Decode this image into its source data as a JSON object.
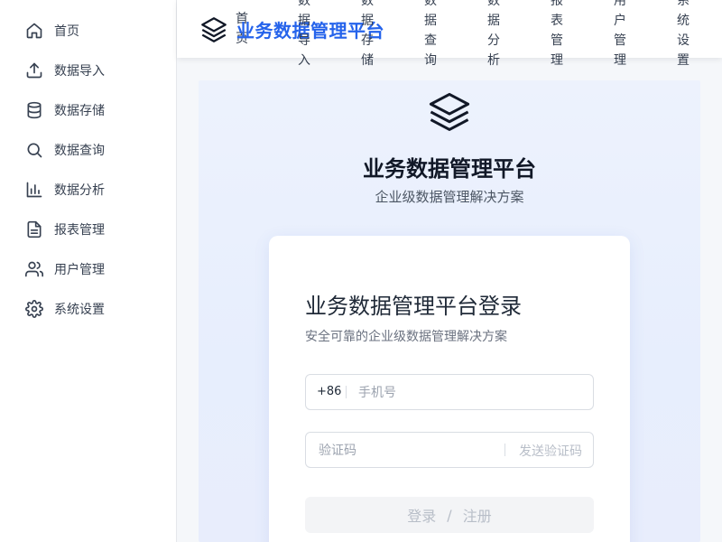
{
  "sidebar": {
    "items": [
      {
        "label": "首页",
        "icon": "home-icon"
      },
      {
        "label": "数据导入",
        "icon": "upload-icon"
      },
      {
        "label": "数据存储",
        "icon": "database-icon"
      },
      {
        "label": "数据查询",
        "icon": "search-icon"
      },
      {
        "label": "数据分析",
        "icon": "bar-chart-icon"
      },
      {
        "label": "报表管理",
        "icon": "file-text-icon"
      },
      {
        "label": "用户管理",
        "icon": "users-icon"
      },
      {
        "label": "系统设置",
        "icon": "gear-icon"
      }
    ]
  },
  "header": {
    "brand": "业务数据管理平台",
    "nav": [
      "首页",
      "数据导入",
      "数据存储",
      "数据查询",
      "数据分析",
      "报表管理",
      "用户管理",
      "系统设置"
    ]
  },
  "panel": {
    "title": "业务数据管理平台",
    "subtitle": "企业级数据管理解决方案"
  },
  "login": {
    "title": "业务数据管理平台登录",
    "subtitle": "安全可靠的企业级数据管理解决方案",
    "phone_prefix": "+86",
    "phone_placeholder": "手机号",
    "code_placeholder": "验证码",
    "send_code": "发送验证码",
    "login_label": "登录",
    "separator": "/",
    "register_label": "注册"
  },
  "colors": {
    "brand": "#2563eb",
    "panel_bg": "#edf2fd",
    "button_disabled": "#f3f4f6"
  }
}
